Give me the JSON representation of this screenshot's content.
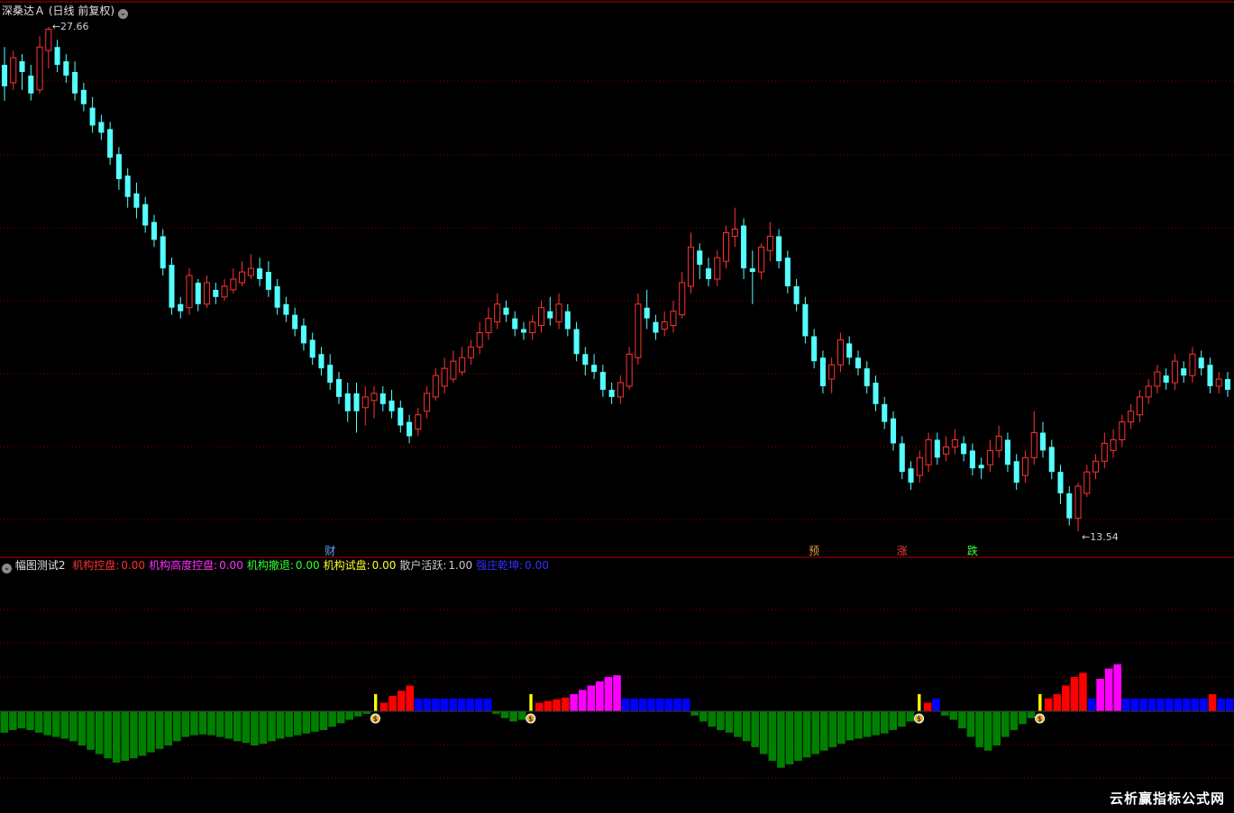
{
  "main_panel": {
    "title": "深桑达Ａ",
    "period": "(日线 前复权)",
    "dropdown_icon": "chevron-down-icon",
    "max_price_label": "27.66",
    "min_price_label": "13.54",
    "markers": [
      {
        "text": "财",
        "color": "#5fa8ff"
      },
      {
        "text": "预",
        "color": "#e0a040"
      },
      {
        "text": "涨",
        "color": "#ff4040"
      },
      {
        "text": "跌",
        "color": "#40ff40"
      }
    ]
  },
  "indicator_panel": {
    "name": "幅图测试2",
    "dropdown_icon": "chevron-down-icon",
    "fields": [
      {
        "label": "机构控盘:",
        "value": "0.00",
        "color": "#ff3030"
      },
      {
        "label": "机构高度控盘:",
        "value": "0.00",
        "color": "#ff30ff"
      },
      {
        "label": "机构撤退:",
        "value": "0.00",
        "color": "#30ff30"
      },
      {
        "label": "机构试盘:",
        "value": "0.00",
        "color": "#ffff30"
      },
      {
        "label": "散户活跃:",
        "value": "1.00",
        "color": "#c8c8c8"
      },
      {
        "label": "强庄乾坤:",
        "value": "0.00",
        "color": "#3030ff"
      }
    ],
    "signal_icon": "money-bag-icon"
  },
  "watermark": "云析赢指标公式网",
  "colors": {
    "up": "#ff3232",
    "down": "#54ffff",
    "grid": "#8a0000",
    "green_bar": "#008000",
    "blue_bar": "#0000ff",
    "magenta_bar": "#ff00ff",
    "red_bar": "#ff0000",
    "yellow_bar": "#ffff00"
  },
  "chart_data": {
    "type": "candlestick",
    "candles_note": "daily OHLC, price scale ~13.54 to 27.66",
    "candles": [
      [
        26.6,
        26.0,
        27.1,
        25.6
      ],
      [
        26.1,
        26.8,
        27.0,
        25.9
      ],
      [
        26.7,
        26.4,
        26.9,
        25.9
      ],
      [
        26.3,
        25.8,
        26.6,
        25.6
      ],
      [
        25.9,
        27.1,
        27.4,
        25.8
      ],
      [
        27.0,
        27.6,
        27.66,
        26.5
      ],
      [
        27.1,
        26.6,
        27.3,
        26.4
      ],
      [
        26.7,
        26.3,
        26.9,
        26.1
      ],
      [
        26.4,
        25.8,
        26.7,
        25.6
      ],
      [
        25.9,
        25.5,
        26.1,
        25.3
      ],
      [
        25.4,
        24.9,
        25.7,
        24.7
      ],
      [
        25.0,
        24.7,
        25.2,
        24.5
      ],
      [
        24.8,
        24.0,
        25.0,
        23.8
      ],
      [
        24.1,
        23.4,
        24.3,
        23.1
      ],
      [
        23.5,
        22.9,
        23.7,
        22.6
      ],
      [
        23.0,
        22.6,
        23.3,
        22.3
      ],
      [
        22.7,
        22.1,
        22.9,
        21.9
      ],
      [
        22.2,
        21.7,
        22.4,
        21.5
      ],
      [
        21.8,
        20.9,
        22.0,
        20.7
      ],
      [
        21.0,
        19.8,
        21.2,
        19.6
      ],
      [
        19.9,
        19.7,
        20.1,
        19.5
      ],
      [
        19.8,
        20.7,
        20.9,
        19.6
      ],
      [
        20.5,
        19.9,
        20.6,
        19.7
      ],
      [
        19.9,
        20.5,
        20.7,
        19.8
      ],
      [
        20.3,
        20.1,
        20.5,
        19.9
      ],
      [
        20.1,
        20.4,
        20.6,
        20.0
      ],
      [
        20.3,
        20.6,
        20.9,
        20.2
      ],
      [
        20.5,
        20.8,
        21.1,
        20.4
      ],
      [
        20.7,
        20.9,
        21.3,
        20.6
      ],
      [
        20.9,
        20.6,
        21.2,
        20.4
      ],
      [
        20.8,
        20.3,
        21.1,
        20.1
      ],
      [
        20.4,
        19.8,
        20.6,
        19.6
      ],
      [
        19.9,
        19.6,
        20.1,
        19.4
      ],
      [
        19.6,
        19.2,
        19.8,
        19.0
      ],
      [
        19.3,
        18.8,
        19.5,
        18.6
      ],
      [
        18.9,
        18.4,
        19.1,
        18.2
      ],
      [
        18.5,
        18.1,
        18.7,
        17.9
      ],
      [
        18.2,
        17.7,
        18.5,
        17.5
      ],
      [
        17.8,
        17.3,
        18.0,
        17.1
      ],
      [
        17.4,
        16.9,
        17.7,
        16.6
      ],
      [
        17.4,
        16.9,
        17.7,
        16.3
      ],
      [
        17.0,
        17.3,
        17.6,
        16.5
      ],
      [
        17.2,
        17.4,
        17.6,
        16.7
      ],
      [
        17.4,
        17.1,
        17.6,
        16.9
      ],
      [
        17.2,
        16.9,
        17.5,
        16.7
      ],
      [
        17.0,
        16.5,
        17.2,
        16.3
      ],
      [
        16.6,
        16.2,
        16.8,
        16.0
      ],
      [
        16.4,
        16.8,
        17.0,
        16.2
      ],
      [
        16.9,
        17.4,
        17.6,
        16.7
      ],
      [
        17.3,
        17.9,
        18.1,
        17.2
      ],
      [
        17.6,
        18.1,
        18.4,
        17.4
      ],
      [
        17.8,
        18.3,
        18.6,
        17.7
      ],
      [
        18.0,
        18.4,
        18.7,
        17.9
      ],
      [
        18.4,
        18.7,
        18.9,
        18.2
      ],
      [
        18.7,
        19.1,
        19.4,
        18.5
      ],
      [
        19.1,
        19.5,
        19.8,
        18.9
      ],
      [
        19.4,
        19.9,
        20.2,
        19.2
      ],
      [
        19.8,
        19.6,
        20.0,
        19.4
      ],
      [
        19.5,
        19.2,
        19.7,
        19.0
      ],
      [
        19.2,
        19.1,
        19.4,
        18.9
      ],
      [
        19.1,
        19.4,
        19.6,
        18.9
      ],
      [
        19.3,
        19.8,
        20.0,
        19.1
      ],
      [
        19.7,
        19.5,
        20.1,
        19.3
      ],
      [
        19.4,
        19.9,
        20.2,
        19.2
      ],
      [
        19.7,
        19.2,
        19.9,
        19.0
      ],
      [
        19.2,
        18.5,
        19.4,
        18.3
      ],
      [
        18.5,
        18.2,
        18.7,
        17.9
      ],
      [
        18.2,
        18.0,
        18.5,
        17.8
      ],
      [
        18.0,
        17.5,
        18.2,
        17.3
      ],
      [
        17.5,
        17.3,
        17.7,
        17.1
      ],
      [
        17.3,
        17.7,
        17.9,
        17.1
      ],
      [
        17.6,
        18.5,
        18.7,
        17.5
      ],
      [
        18.4,
        19.9,
        20.2,
        18.2
      ],
      [
        19.8,
        19.5,
        20.3,
        19.2
      ],
      [
        19.4,
        19.1,
        19.6,
        18.9
      ],
      [
        19.2,
        19.4,
        19.7,
        19.0
      ],
      [
        19.3,
        19.7,
        20.0,
        19.1
      ],
      [
        19.6,
        20.5,
        20.8,
        19.5
      ],
      [
        20.4,
        21.5,
        21.9,
        20.2
      ],
      [
        21.4,
        21.0,
        21.6,
        20.6
      ],
      [
        20.9,
        20.6,
        21.2,
        20.4
      ],
      [
        20.6,
        21.2,
        21.4,
        20.4
      ],
      [
        21.1,
        21.9,
        22.1,
        20.9
      ],
      [
        21.8,
        22.0,
        22.6,
        21.5
      ],
      [
        22.1,
        20.9,
        22.3,
        20.6
      ],
      [
        20.9,
        20.8,
        21.4,
        19.9
      ],
      [
        20.8,
        21.5,
        21.6,
        20.6
      ],
      [
        21.4,
        21.8,
        22.2,
        21.1
      ],
      [
        21.8,
        21.1,
        22.0,
        20.9
      ],
      [
        21.2,
        20.4,
        21.4,
        20.2
      ],
      [
        20.4,
        19.9,
        20.6,
        19.7
      ],
      [
        19.9,
        19.0,
        20.1,
        18.8
      ],
      [
        19.0,
        18.3,
        19.2,
        18.1
      ],
      [
        18.4,
        17.6,
        18.6,
        17.4
      ],
      [
        17.8,
        18.2,
        18.4,
        17.4
      ],
      [
        18.2,
        18.9,
        19.1,
        18.0
      ],
      [
        18.8,
        18.4,
        19.0,
        18.2
      ],
      [
        18.4,
        18.1,
        18.6,
        17.9
      ],
      [
        18.1,
        17.6,
        18.3,
        17.4
      ],
      [
        17.7,
        17.1,
        17.9,
        16.9
      ],
      [
        17.1,
        16.6,
        17.3,
        16.4
      ],
      [
        16.7,
        16.0,
        16.9,
        15.8
      ],
      [
        16.0,
        15.2,
        16.2,
        15.0
      ],
      [
        15.3,
        14.9,
        15.5,
        14.7
      ],
      [
        15.1,
        15.6,
        15.8,
        14.9
      ],
      [
        15.4,
        16.1,
        16.3,
        15.2
      ],
      [
        16.1,
        15.6,
        16.3,
        15.4
      ],
      [
        15.7,
        15.9,
        16.2,
        15.5
      ],
      [
        15.9,
        16.1,
        16.4,
        15.7
      ],
      [
        16.0,
        15.7,
        16.2,
        15.5
      ],
      [
        15.8,
        15.3,
        16.0,
        15.1
      ],
      [
        15.4,
        15.3,
        15.6,
        15.0
      ],
      [
        15.4,
        15.8,
        16.1,
        15.2
      ],
      [
        15.8,
        16.2,
        16.5,
        15.6
      ],
      [
        16.1,
        15.4,
        16.3,
        15.2
      ],
      [
        15.5,
        14.9,
        15.7,
        14.7
      ],
      [
        15.1,
        15.6,
        15.8,
        14.9
      ],
      [
        15.6,
        16.3,
        16.9,
        15.4
      ],
      [
        16.3,
        15.8,
        16.6,
        15.6
      ],
      [
        15.9,
        15.2,
        16.1,
        15.0
      ],
      [
        15.2,
        14.6,
        15.4,
        14.3
      ],
      [
        14.6,
        13.9,
        14.8,
        13.7
      ],
      [
        13.9,
        14.8,
        14.9,
        13.54
      ],
      [
        14.6,
        15.2,
        15.4,
        14.5
      ],
      [
        15.2,
        15.5,
        15.7,
        15.0
      ],
      [
        15.5,
        16.0,
        16.3,
        15.3
      ],
      [
        15.8,
        16.1,
        16.4,
        15.6
      ],
      [
        16.1,
        16.6,
        16.8,
        15.9
      ],
      [
        16.6,
        16.9,
        17.1,
        16.4
      ],
      [
        16.8,
        17.3,
        17.5,
        16.6
      ],
      [
        17.3,
        17.6,
        17.8,
        17.1
      ],
      [
        17.6,
        18.0,
        18.2,
        17.4
      ],
      [
        17.9,
        17.7,
        18.1,
        17.5
      ],
      [
        17.7,
        18.3,
        18.5,
        17.5
      ],
      [
        18.1,
        17.9,
        18.3,
        17.7
      ],
      [
        17.9,
        18.5,
        18.7,
        17.7
      ],
      [
        18.4,
        18.1,
        18.6,
        17.9
      ],
      [
        18.2,
        17.6,
        18.4,
        17.4
      ],
      [
        17.6,
        17.8,
        18.0,
        17.4
      ],
      [
        17.8,
        17.5,
        18.0,
        17.3
      ]
    ],
    "indicator_values": [
      -0.25,
      -0.22,
      -0.2,
      -0.22,
      -0.25,
      -0.28,
      -0.3,
      -0.32,
      -0.35,
      -0.4,
      -0.45,
      -0.5,
      -0.55,
      -0.6,
      -0.58,
      -0.55,
      -0.52,
      -0.48,
      -0.44,
      -0.4,
      -0.35,
      -0.3,
      -0.28,
      -0.27,
      -0.28,
      -0.3,
      -0.32,
      -0.35,
      -0.37,
      -0.4,
      -0.38,
      -0.35,
      -0.32,
      -0.3,
      -0.28,
      -0.26,
      -0.24,
      -0.22,
      -0.18,
      -0.14,
      -0.1,
      -0.06,
      -0.03,
      0.2,
      0.1,
      0.18,
      0.24,
      0.3,
      0.15,
      0.15,
      0.15,
      0.15,
      0.15,
      0.15,
      0.15,
      0.15,
      0.15,
      -0.03,
      -0.08,
      -0.12,
      -0.1,
      0.2,
      0.1,
      0.12,
      0.14,
      0.16,
      0.2,
      0.25,
      0.3,
      0.35,
      0.4,
      0.42,
      0.15,
      0.15,
      0.15,
      0.15,
      0.15,
      0.15,
      0.15,
      0.15,
      -0.05,
      -0.12,
      -0.18,
      -0.22,
      -0.25,
      -0.3,
      -0.35,
      -0.42,
      -0.5,
      -0.58,
      -0.66,
      -0.62,
      -0.58,
      -0.54,
      -0.5,
      -0.46,
      -0.42,
      -0.38,
      -0.34,
      -0.32,
      -0.3,
      -0.28,
      -0.26,
      -0.22,
      -0.18,
      -0.12,
      0.2,
      0.1,
      0.15,
      -0.05,
      -0.1,
      -0.2,
      -0.3,
      -0.42,
      -0.46,
      -0.4,
      -0.3,
      -0.22,
      -0.15,
      -0.08,
      0.2,
      0.15,
      0.2,
      0.3,
      0.4,
      0.45,
      0.15,
      0.38,
      0.5,
      0.55,
      0.15,
      0.15,
      0.15,
      0.15,
      0.15,
      0.15,
      0.15,
      0.15,
      0.15,
      0.15,
      0.2,
      0.15,
      0.15
    ],
    "indicator_types": [
      "g",
      "g",
      "g",
      "g",
      "g",
      "g",
      "g",
      "g",
      "g",
      "g",
      "g",
      "g",
      "g",
      "g",
      "g",
      "g",
      "g",
      "g",
      "g",
      "g",
      "g",
      "g",
      "g",
      "g",
      "g",
      "g",
      "g",
      "g",
      "g",
      "g",
      "g",
      "g",
      "g",
      "g",
      "g",
      "g",
      "g",
      "g",
      "g",
      "g",
      "g",
      "g",
      "g",
      "y",
      "r",
      "r",
      "r",
      "r",
      "b",
      "b",
      "b",
      "b",
      "b",
      "b",
      "b",
      "b",
      "b",
      "g",
      "g",
      "g",
      "g",
      "y",
      "r",
      "r",
      "r",
      "r",
      "m",
      "m",
      "m",
      "m",
      "m",
      "m",
      "b",
      "b",
      "b",
      "b",
      "b",
      "b",
      "b",
      "b",
      "g",
      "g",
      "g",
      "g",
      "g",
      "g",
      "g",
      "g",
      "g",
      "g",
      "g",
      "g",
      "g",
      "g",
      "g",
      "g",
      "g",
      "g",
      "g",
      "g",
      "g",
      "g",
      "g",
      "g",
      "g",
      "g",
      "y",
      "r",
      "b",
      "g",
      "g",
      "g",
      "g",
      "g",
      "g",
      "g",
      "g",
      "g",
      "g",
      "g",
      "y",
      "r",
      "r",
      "r",
      "r",
      "r",
      "b",
      "m",
      "m",
      "m",
      "b",
      "b",
      "b",
      "b",
      "b",
      "b",
      "b",
      "b",
      "b",
      "b",
      "r",
      "b",
      "b"
    ]
  }
}
